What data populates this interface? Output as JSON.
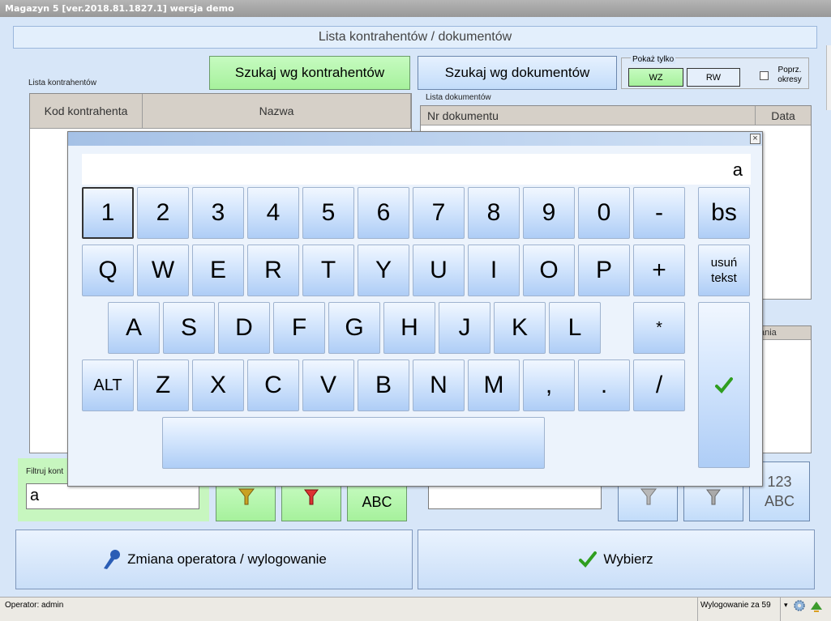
{
  "app": {
    "title": "Magazyn 5 [ver.2018.81.1827.1]  wersja demo"
  },
  "header": {
    "title": "Lista kontrahentów / dokumentów"
  },
  "search": {
    "by_contractors": "Szukaj wg kontrahentów",
    "by_documents": "Szukaj wg dokumentów"
  },
  "filter_group": {
    "legend": "Pokaż tylko",
    "wz": "WZ",
    "rw": "RW",
    "prev_periods": "Poprz. okresy"
  },
  "contractors": {
    "label": "Lista kontrahentów",
    "col_code": "Kod kontrahenta",
    "col_name": "Nazwa",
    "filter_label": "Filtruj kont",
    "filter_value": "a",
    "abc_label": "ABC"
  },
  "documents": {
    "label": "Lista dokumentów",
    "col_number": "Nr dokumentu",
    "col_date": "Data",
    "col_partial": "ania",
    "numpad_label": "123",
    "abc_label": "ABC"
  },
  "actions": {
    "change_operator": "Zmiana operatora / wylogowanie",
    "select": "Wybierz"
  },
  "status": {
    "operator": "Operator: admin",
    "logout": "Wylogowanie za 59"
  },
  "keyboard": {
    "display_value": "a",
    "close": "×",
    "row1": [
      "1",
      "2",
      "3",
      "4",
      "5",
      "6",
      "7",
      "8",
      "9",
      "0",
      "-"
    ],
    "row2": [
      "Q",
      "W",
      "E",
      "R",
      "T",
      "Y",
      "U",
      "I",
      "O",
      "P",
      "+"
    ],
    "row3": [
      "A",
      "S",
      "D",
      "F",
      "G",
      "H",
      "J",
      "K",
      "L"
    ],
    "row3_extra": "*",
    "row4": [
      "Z",
      "X",
      "C",
      "V",
      "B",
      "N",
      "M",
      ",",
      ".",
      "/"
    ],
    "alt": "ALT",
    "backspace": "bs",
    "clear": "usuń tekst"
  },
  "colors": {
    "accent_green": "#a6f19c",
    "accent_blue": "#c2dcfa",
    "check_green": "#2f9e1f"
  },
  "icons": {
    "filter": "filter-funnel-icon",
    "clear_filter": "clear-filter-icon",
    "operator": "user-key-icon",
    "check": "check-icon",
    "settings": "gear-icon"
  }
}
